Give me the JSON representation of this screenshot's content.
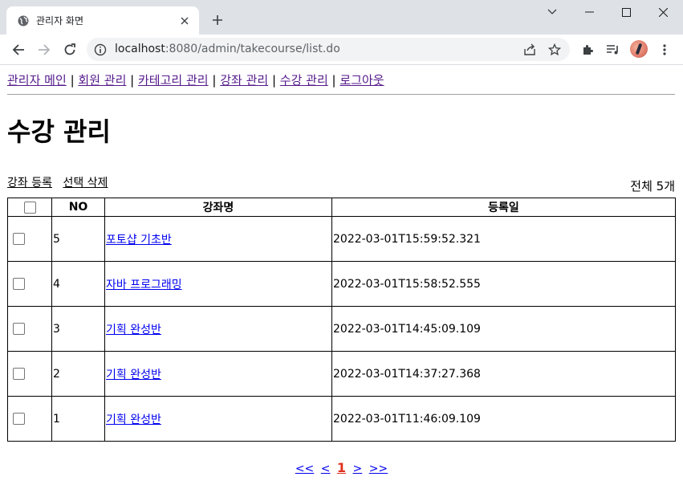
{
  "browser": {
    "tab_title": "관리자 화면",
    "url_host": "localhost",
    "url_rest": ":8080/admin/takecourse/list.do",
    "icons": {
      "favicon": "globe-icon",
      "close": "close-icon",
      "new_tab": "plus-icon",
      "minimize": "minimize-icon",
      "maximize": "maximize-icon",
      "window_close": "window-close-icon",
      "chevron": "chevron-down-icon",
      "back": "back-arrow-icon",
      "forward": "forward-arrow-icon",
      "reload": "reload-icon",
      "info": "info-icon",
      "share": "share-icon",
      "bookmark": "star-icon",
      "extensions": "puzzle-icon",
      "media": "media-queue-icon",
      "menu": "kebab-menu-icon"
    }
  },
  "nav": {
    "items": [
      "관리자 메인",
      "회원 관리",
      "카테고리 관리",
      "강좌 관리",
      "수강 관리",
      "로그아웃"
    ],
    "separator": "|"
  },
  "page": {
    "title": "수강 관리",
    "actions": [
      "강좌 등록",
      "선택 삭제"
    ],
    "total": "전체 5개"
  },
  "table": {
    "headers": [
      "NO",
      "강좌명",
      "등록일"
    ],
    "rows": [
      {
        "no": "5",
        "name": "포토샵 기초반",
        "date": "2022-03-01T15:59:52.321"
      },
      {
        "no": "4",
        "name": "자바 프로그래밍",
        "date": "2022-03-01T15:58:52.555"
      },
      {
        "no": "3",
        "name": "기획 완성반",
        "date": "2022-03-01T14:45:09.109"
      },
      {
        "no": "2",
        "name": "기획 완성반",
        "date": "2022-03-01T14:37:27.368"
      },
      {
        "no": "1",
        "name": "기획 완성반",
        "date": "2022-03-01T11:46:09.109"
      }
    ]
  },
  "pager": {
    "first": "<<",
    "prev": "<",
    "current": "1",
    "next": ">",
    "last": ">>"
  },
  "colors": {
    "visited_link": "#551a8b",
    "link": "#0000ee",
    "current_page": "#e0301e",
    "tabbar": "#dee1e6"
  }
}
